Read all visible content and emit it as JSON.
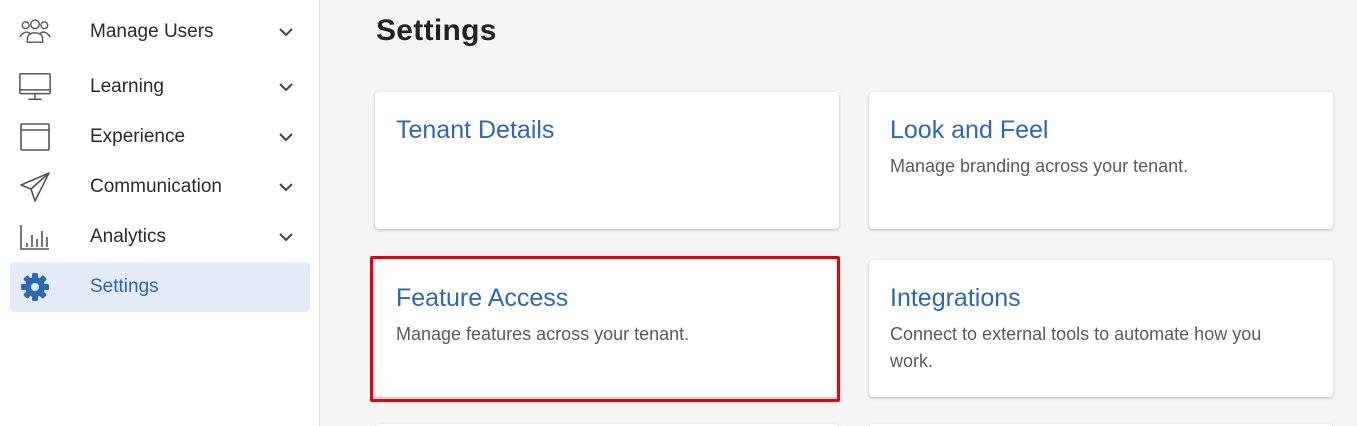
{
  "sidebar": {
    "items": [
      {
        "label": "Manage Users",
        "icon": "users-icon",
        "expandable": true
      },
      {
        "label": "Learning",
        "icon": "monitor-icon",
        "expandable": true
      },
      {
        "label": "Experience",
        "icon": "browser-window-icon",
        "expandable": true
      },
      {
        "label": "Communication",
        "icon": "paper-plane-icon",
        "expandable": true
      },
      {
        "label": "Analytics",
        "icon": "bar-chart-icon",
        "expandable": true
      },
      {
        "label": "Settings",
        "icon": "gear-icon",
        "expandable": false,
        "active": true
      }
    ]
  },
  "main": {
    "title": "Settings",
    "cards": [
      {
        "title": "Tenant Details",
        "description": ""
      },
      {
        "title": "Look and Feel",
        "description": "Manage branding across your tenant."
      },
      {
        "title": "Feature Access",
        "description": "Manage features across your tenant.",
        "highlighted": true
      },
      {
        "title": "Integrations",
        "description": "Connect to external tools to automate how you work."
      }
    ]
  },
  "colors": {
    "accent": "#2b68b8",
    "highlight": "#e8000b",
    "active_bg": "#e4ecf7"
  }
}
